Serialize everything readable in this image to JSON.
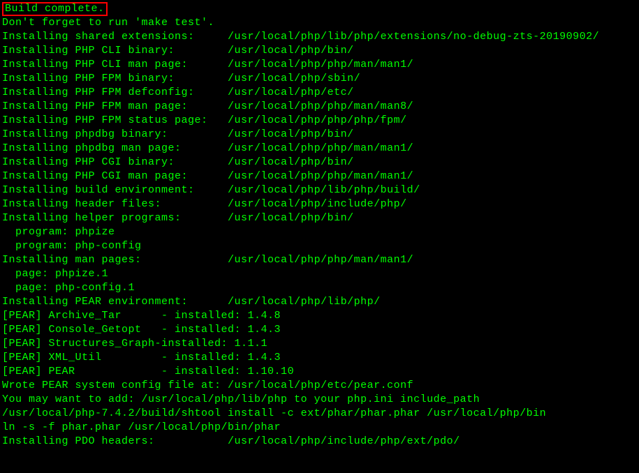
{
  "highlight_text": "Build complete.",
  "notice": "Don't forget to run 'make test'.",
  "install_rows": [
    {
      "label": "Installing shared extensions:",
      "path": "/usr/local/php/lib/php/extensions/no-debug-zts-20190902/"
    },
    {
      "label": "Installing PHP CLI binary:",
      "path": "/usr/local/php/bin/"
    },
    {
      "label": "Installing PHP CLI man page:",
      "path": "/usr/local/php/php/man/man1/"
    },
    {
      "label": "Installing PHP FPM binary:",
      "path": "/usr/local/php/sbin/"
    },
    {
      "label": "Installing PHP FPM defconfig:",
      "path": "/usr/local/php/etc/"
    },
    {
      "label": "Installing PHP FPM man page:",
      "path": "/usr/local/php/php/man/man8/"
    },
    {
      "label": "Installing PHP FPM status page:",
      "path": "/usr/local/php/php/php/fpm/"
    },
    {
      "label": "Installing phpdbg binary:",
      "path": "/usr/local/php/bin/"
    },
    {
      "label": "Installing phpdbg man page:",
      "path": "/usr/local/php/php/man/man1/"
    },
    {
      "label": "Installing PHP CGI binary:",
      "path": "/usr/local/php/bin/"
    },
    {
      "label": "Installing PHP CGI man page:",
      "path": "/usr/local/php/php/man/man1/"
    },
    {
      "label": "Installing build environment:",
      "path": "/usr/local/php/lib/php/build/"
    },
    {
      "label": "Installing header files:",
      "path": "/usr/local/php/include/php/"
    },
    {
      "label": "Installing helper programs:",
      "path": "/usr/local/php/bin/"
    }
  ],
  "helper_programs": [
    "  program: phpize",
    "  program: php-config"
  ],
  "man_pages_label": "Installing man pages:",
  "man_pages_path": "/usr/local/php/php/man/man1/",
  "man_pages": [
    "  page: phpize.1",
    "  page: php-config.1"
  ],
  "pear_env_label": "Installing PEAR environment:",
  "pear_env_path": "/usr/local/php/lib/php/",
  "pear_pkgs": [
    {
      "name": "[PEAR] Archive_Tar",
      "sep": "- installed:",
      "ver": "1.4.8"
    },
    {
      "name": "[PEAR] Console_Getopt",
      "sep": "- installed:",
      "ver": "1.4.3"
    },
    {
      "name": "[PEAR] Structures_Graph-",
      "sep": "installed:",
      "ver": "1.1.1"
    },
    {
      "name": "[PEAR] XML_Util",
      "sep": "- installed:",
      "ver": "1.4.3"
    },
    {
      "name": "[PEAR] PEAR",
      "sep": "- installed:",
      "ver": "1.10.10"
    }
  ],
  "trailing_lines": [
    "Wrote PEAR system config file at: /usr/local/php/etc/pear.conf",
    "You may want to add: /usr/local/php/lib/php to your php.ini include_path",
    "/usr/local/php-7.4.2/build/shtool install -c ext/phar/phar.phar /usr/local/php/bin",
    "ln -s -f phar.phar /usr/local/php/bin/phar",
    "Installing PDO headers:           /usr/local/php/include/php/ext/pdo/"
  ]
}
